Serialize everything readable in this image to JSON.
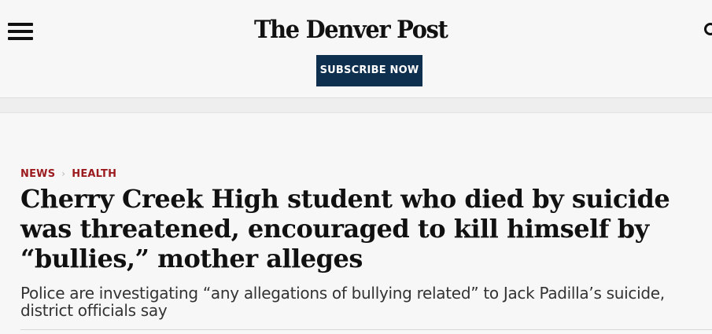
{
  "header": {
    "menu_icon": "hamburger-menu-icon",
    "logo_text": "The Denver Post",
    "subscribe_label": "SUBSCRIBE NOW",
    "search_icon": "search-icon",
    "subscribe_color": "#0f2f4f"
  },
  "breadcrumb": {
    "items": [
      "NEWS",
      "HEALTH"
    ],
    "separator_icon": "chevron-right-icon",
    "color": "#9b1b1f"
  },
  "article": {
    "headline": "Cherry Creek High student who died by suicide was threatened, encouraged to kill himself by “bullies,” mother alleges",
    "dek": "Police are investigating “any allegations of bullying related” to Jack Padilla’s suicide, district officials say"
  }
}
